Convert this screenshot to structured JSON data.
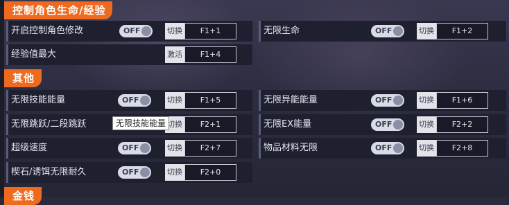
{
  "sections": [
    {
      "title": "控制角色生命/经验"
    },
    {
      "title": "其他"
    },
    {
      "title": "金钱"
    }
  ],
  "toggle_off_label": "OFF",
  "rows": [
    {
      "label": "开启控制角色修改",
      "action": "切换",
      "hotkey": "F1+1"
    },
    {
      "label": "无限生命",
      "action": "切换",
      "hotkey": "F1+2"
    },
    {
      "label": "经验值最大",
      "action": "激活",
      "hotkey": "F1+4"
    },
    {
      "label": "无限技能能量",
      "action": "切换",
      "hotkey": "F1+5"
    },
    {
      "label": "无限异能能量",
      "action": "切换",
      "hotkey": "F1+6"
    },
    {
      "label": "无限跳跃/二段跳跃",
      "action": "切换",
      "hotkey": "F2+1"
    },
    {
      "label": "无限EX能量",
      "action": "切换",
      "hotkey": "F2+2"
    },
    {
      "label": "超级速度",
      "action": "切换",
      "hotkey": "F2+7"
    },
    {
      "label": "物品材料无限",
      "action": "切换",
      "hotkey": "F2+8"
    },
    {
      "label": "楔石/诱饵无限耐久",
      "action": "切换",
      "hotkey": "F2+0"
    }
  ],
  "tooltip": "无限技能能量",
  "colors": {
    "accent": "#ee6a1f",
    "row_bg": "#1e2030"
  }
}
